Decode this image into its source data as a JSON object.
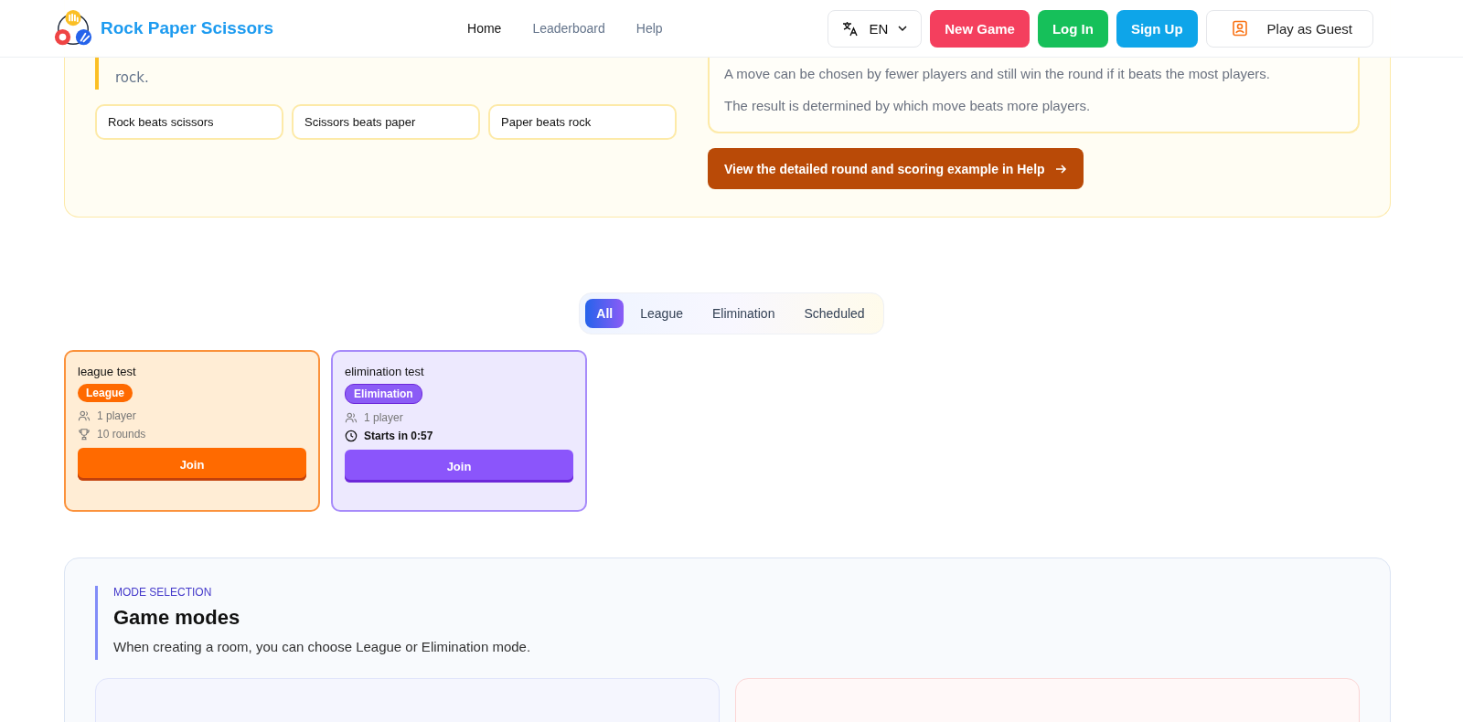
{
  "header": {
    "brand": "Rock Paper Scissors",
    "nav": [
      {
        "label": "Home",
        "selected": true
      },
      {
        "label": "Leaderboard",
        "selected": false
      },
      {
        "label": "Help",
        "selected": false
      }
    ],
    "language": "EN",
    "new_game": "New Game",
    "log_in": "Log In",
    "sign_up": "Sign Up",
    "guest": "Play as Guest"
  },
  "rules": {
    "intro_tail": "rock.",
    "chips": [
      "Rock beats scissors",
      "Scissors beats paper",
      "Paper beats rock"
    ],
    "notes": [
      "A move can be chosen by fewer players and still win the round if it beats the most players.",
      "The result is determined by which move beats more players."
    ],
    "help_button": "View the detailed round and scoring example in Help"
  },
  "filter_tabs": [
    {
      "label": "All",
      "selected": true
    },
    {
      "label": "League",
      "selected": false
    },
    {
      "label": "Elimination",
      "selected": false
    },
    {
      "label": "Scheduled",
      "selected": false
    }
  ],
  "rooms": [
    {
      "name": "league test",
      "kind": "league",
      "badge": "League",
      "players": "1 player",
      "detail": {
        "kind": "rounds",
        "text": "10 rounds"
      },
      "join": "Join"
    },
    {
      "name": "elimination test",
      "kind": "elimination",
      "badge": "Elimination",
      "players": "1 player",
      "detail": {
        "kind": "countdown",
        "text": "Starts in 0:57"
      },
      "join": "Join"
    }
  ],
  "game_modes": {
    "eyebrow": "MODE SELECTION",
    "title": "Game modes",
    "description": "When creating a room, you can choose League or Elimination mode."
  }
}
